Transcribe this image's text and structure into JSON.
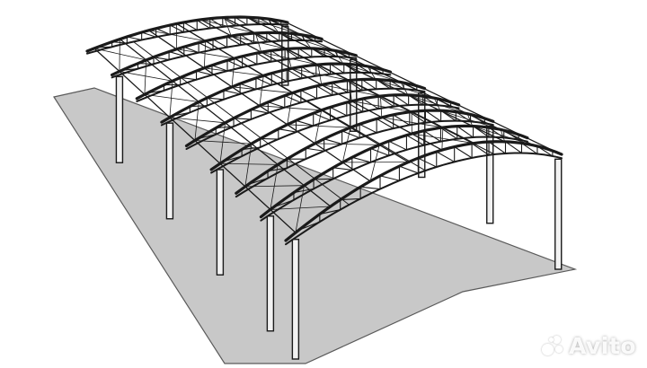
{
  "watermark": {
    "text": "Avito",
    "icon": "avito-dots-icon"
  },
  "colors": {
    "background": "#ffffff",
    "ground": "#c8c8c8",
    "ground_edge": "#5a5a5a",
    "steel": "#1a1a1a",
    "column": "#f2f2f2"
  },
  "structure": {
    "arch_count": 9,
    "columns_per_side": 5
  }
}
